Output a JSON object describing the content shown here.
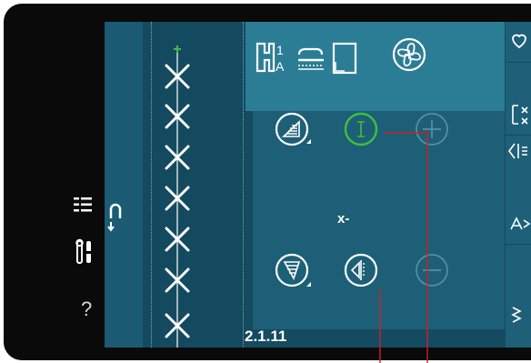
{
  "screen": {
    "version": "2.1.11",
    "parameter_label": "x-"
  },
  "left_nav": {
    "items": [
      {
        "name": "list-view-icon"
      },
      {
        "name": "settings-tools-icon"
      },
      {
        "name": "help-icon",
        "label": "?"
      }
    ]
  },
  "toolbar": {
    "items": [
      {
        "name": "presser-foot-icon",
        "label": "1A"
      },
      {
        "name": "feed-dog-icon"
      },
      {
        "name": "stabilizer-icon"
      },
      {
        "name": "fan-icon"
      }
    ]
  },
  "controls": [
    {
      "name": "stitch-width-button",
      "state": "enabled"
    },
    {
      "name": "cursor-button",
      "state": "active",
      "color": "#3fbf3f"
    },
    {
      "name": "plus-button",
      "state": "disabled"
    },
    {
      "name": "stitch-length-button",
      "state": "enabled"
    },
    {
      "name": "mirror-button",
      "state": "enabled"
    },
    {
      "name": "minus-button",
      "state": "disabled"
    }
  ],
  "colors": {
    "screen_bg": "#154b60",
    "toolbar_bg": "#2b7d95",
    "panel_bg": "#1d5f76",
    "callout_line": "#cc1e2c",
    "active_green": "#3fbf3f"
  }
}
